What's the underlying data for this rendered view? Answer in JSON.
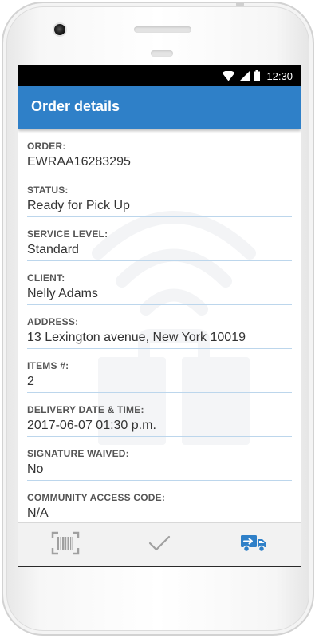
{
  "status_bar": {
    "time": "12:30",
    "icons": [
      "wifi-icon",
      "signal-icon",
      "battery-icon"
    ]
  },
  "app_bar": {
    "title": "Order details",
    "color": "#2f80c8"
  },
  "fields": [
    {
      "label": "ORDER:",
      "value": "EWRAA16283295"
    },
    {
      "label": "STATUS:",
      "value": "Ready for Pick Up"
    },
    {
      "label": "SERVICE LEVEL:",
      "value": "Standard"
    },
    {
      "label": "CLIENT:",
      "value": "Nelly Adams"
    },
    {
      "label": "ADDRESS:",
      "value": "13 Lexington avenue, New York 10019"
    },
    {
      "label": "ITEMS #:",
      "value": "2"
    },
    {
      "label": "DELIVERY DATE & TIME:",
      "value": "2017-06-07 01:30 p.m."
    },
    {
      "label": "SIGNATURE WAIVED:",
      "value": "No"
    },
    {
      "label": "COMMUNITY ACCESS CODE:",
      "value": "N/A"
    }
  ],
  "bottom_nav": {
    "items": [
      {
        "icon": "barcode-scan-icon",
        "active": false
      },
      {
        "icon": "checkmark-icon",
        "active": false
      },
      {
        "icon": "delivery-truck-icon",
        "active": true
      }
    ],
    "active_color": "#2f80c8",
    "inactive_color": "#a0a0a0"
  }
}
